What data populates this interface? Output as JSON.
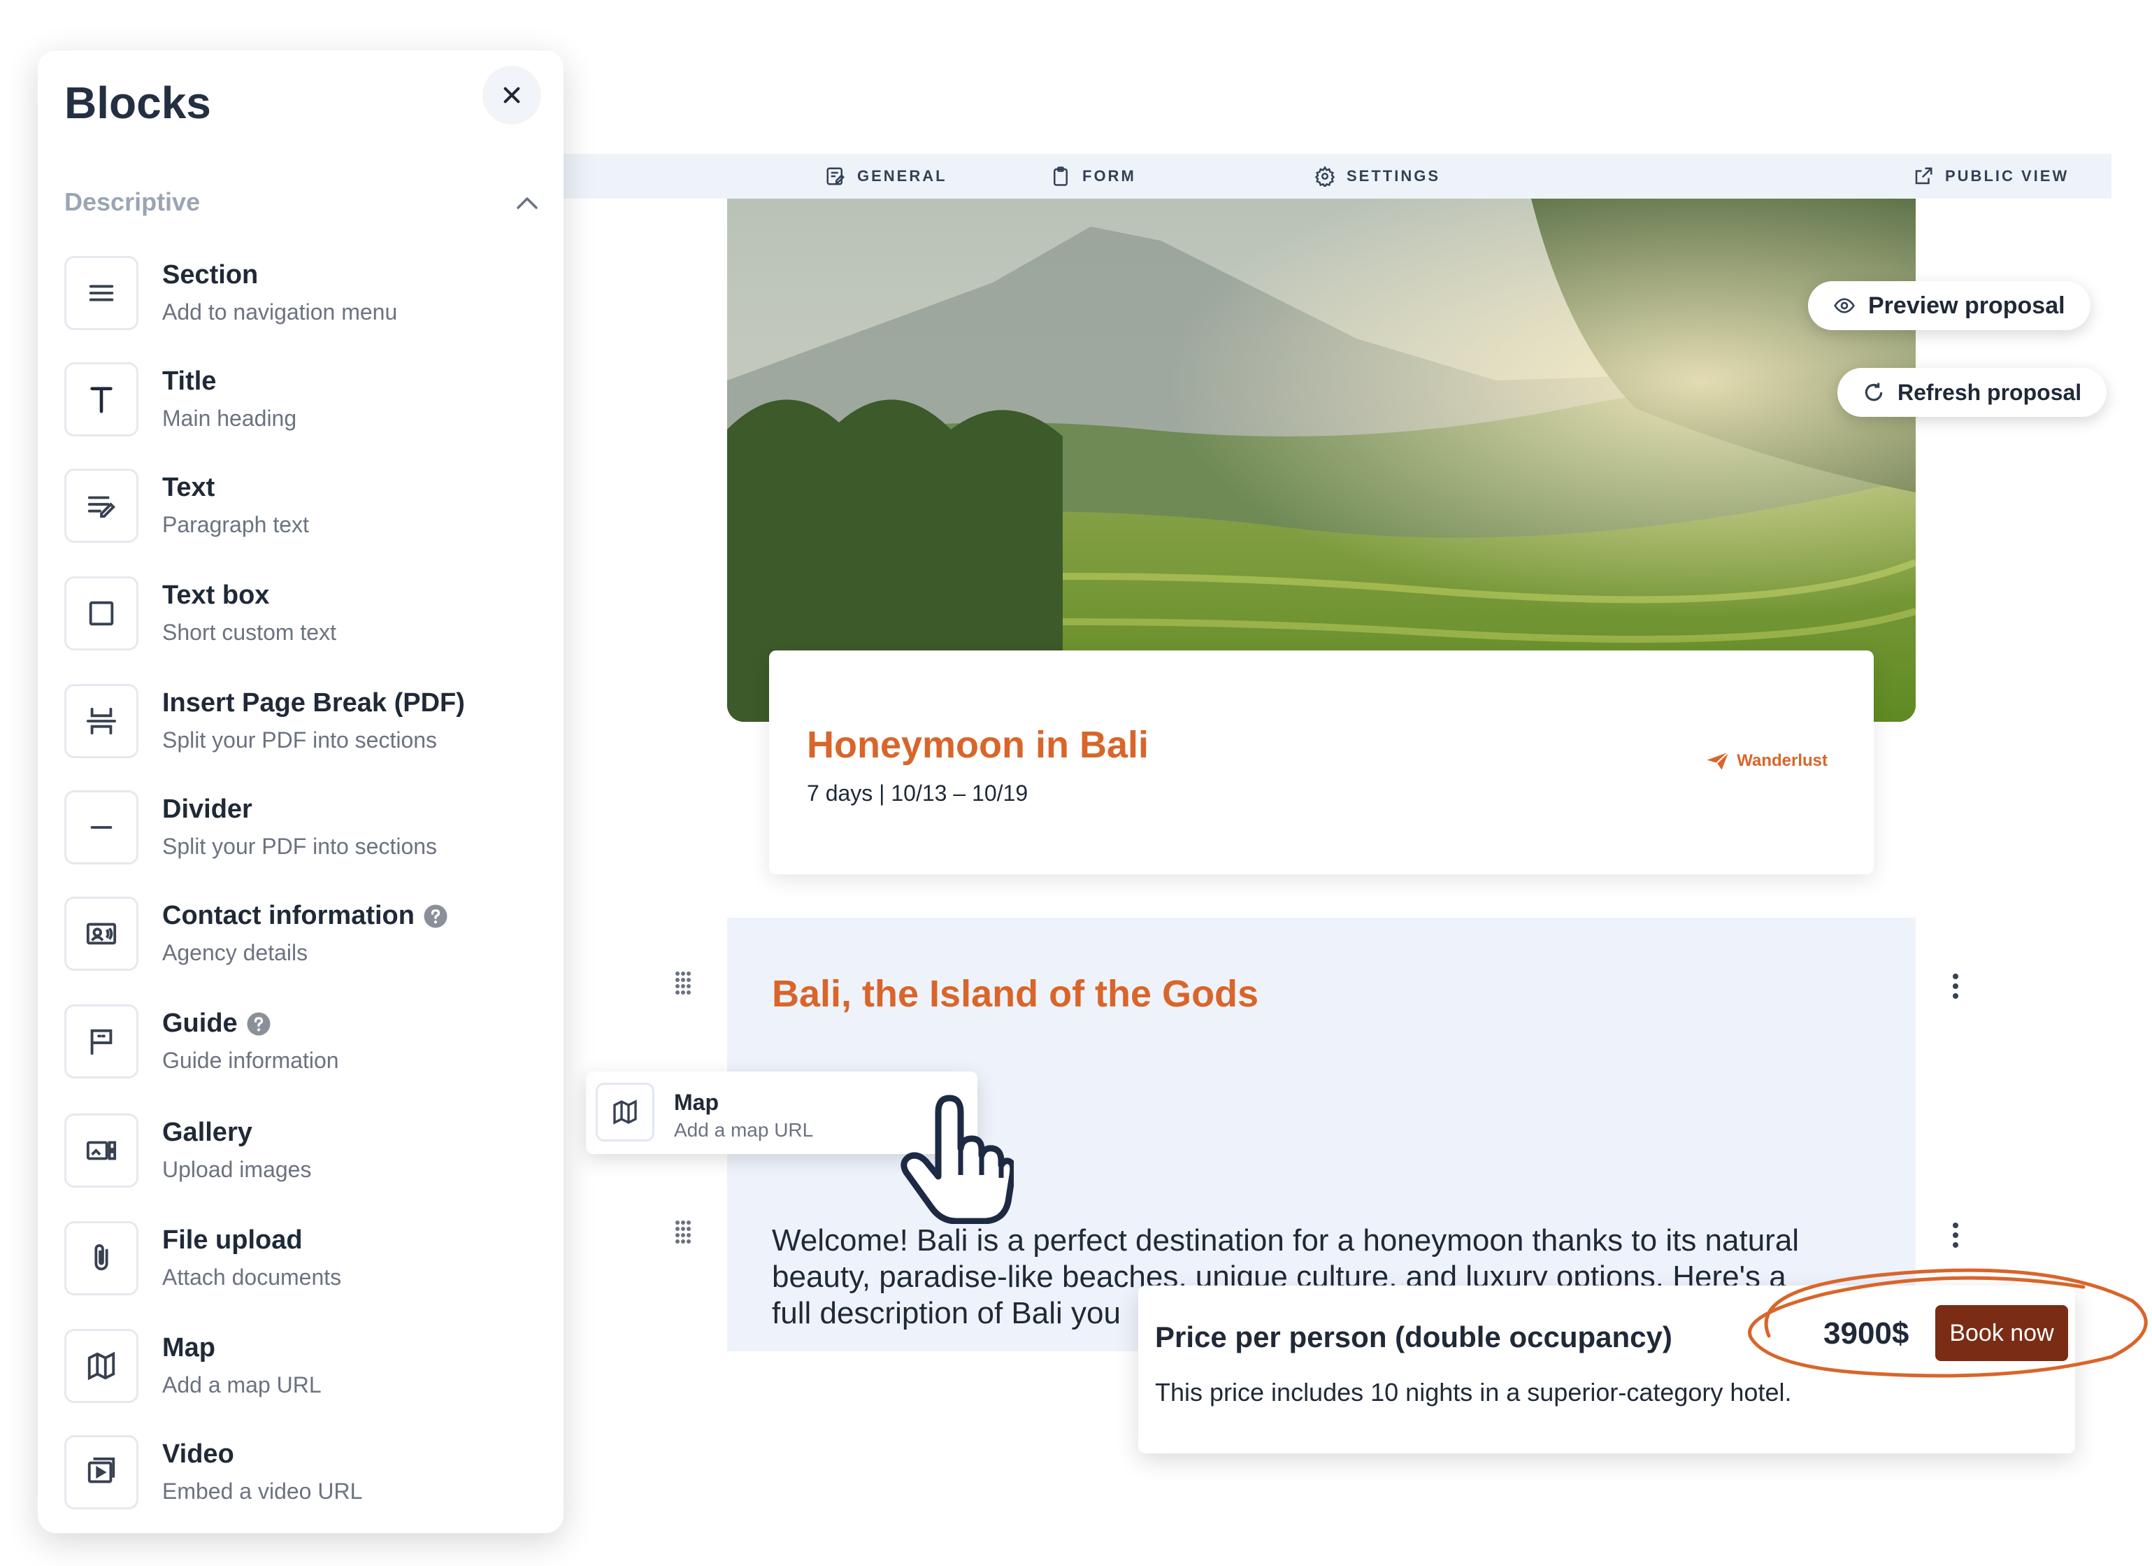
{
  "topbar": {
    "tabs": [
      {
        "label": "GENERAL",
        "icon": "edit-form-icon"
      },
      {
        "label": "FORM",
        "icon": "clipboard-icon"
      },
      {
        "label": "SETTINGS",
        "icon": "gear-icon"
      }
    ],
    "public_view": {
      "label": "PUBLIC VIEW",
      "icon": "external-link-icon"
    }
  },
  "actions": {
    "preview": "Preview proposal",
    "refresh": "Refresh proposal"
  },
  "hero": {
    "title": "Honeymoon in Bali",
    "dates": "7 days | 10/13 – 10/19",
    "brand": "Wanderlust"
  },
  "content": {
    "heading": "Bali, the Island of the Gods",
    "welcome_line1": "Welcome! Bali is a perfect destination for a honeymoon thanks to its natural",
    "welcome_line2": "beauty, paradise-like beaches, unique culture, and luxury options. Here's a",
    "welcome_line3": "full description of Bali you"
  },
  "drag_item": {
    "title": "Map",
    "desc": "Add a map URL",
    "icon": "map-icon"
  },
  "price": {
    "title": "Price per person (double occupancy)",
    "value": "3900$",
    "button": "Book now",
    "desc": "This price includes 10 nights in a superior-category hotel."
  },
  "panel": {
    "title": "Blocks",
    "category": "Descriptive",
    "items": [
      {
        "name": "Section",
        "desc": "Add to navigation menu",
        "icon": "menu-lines-icon",
        "help": false
      },
      {
        "name": "Title",
        "desc": "Main heading",
        "icon": "title-t-icon",
        "help": false
      },
      {
        "name": "Text",
        "desc": "Paragraph text",
        "icon": "text-edit-icon",
        "help": false
      },
      {
        "name": "Text box",
        "desc": "Short custom text",
        "icon": "square-icon",
        "help": false
      },
      {
        "name": "Insert Page Break (PDF)",
        "desc": "Split your PDF into sections",
        "icon": "page-break-icon",
        "help": false
      },
      {
        "name": "Divider",
        "desc": "Split your PDF into sections",
        "icon": "minus-icon",
        "help": false
      },
      {
        "name": "Contact information",
        "desc": "Agency details",
        "icon": "contact-card-icon",
        "help": true
      },
      {
        "name": "Guide",
        "desc": "Guide information",
        "icon": "flag-icon",
        "help": true
      },
      {
        "name": "Gallery",
        "desc": "Upload images",
        "icon": "gallery-icon",
        "help": false
      },
      {
        "name": "File upload",
        "desc": "Attach documents",
        "icon": "paperclip-icon",
        "help": false
      },
      {
        "name": "Map",
        "desc": "Add a map URL",
        "icon": "map-icon",
        "help": false
      },
      {
        "name": "Video",
        "desc": "Embed a video URL",
        "icon": "video-icon",
        "help": false
      }
    ]
  },
  "colors": {
    "accent": "#d9652a",
    "book_button": "#7a2c14",
    "block_bg": "#eef3fb",
    "topbar_bg": "#eef3fa",
    "highlight_circle": "#d9652a"
  }
}
